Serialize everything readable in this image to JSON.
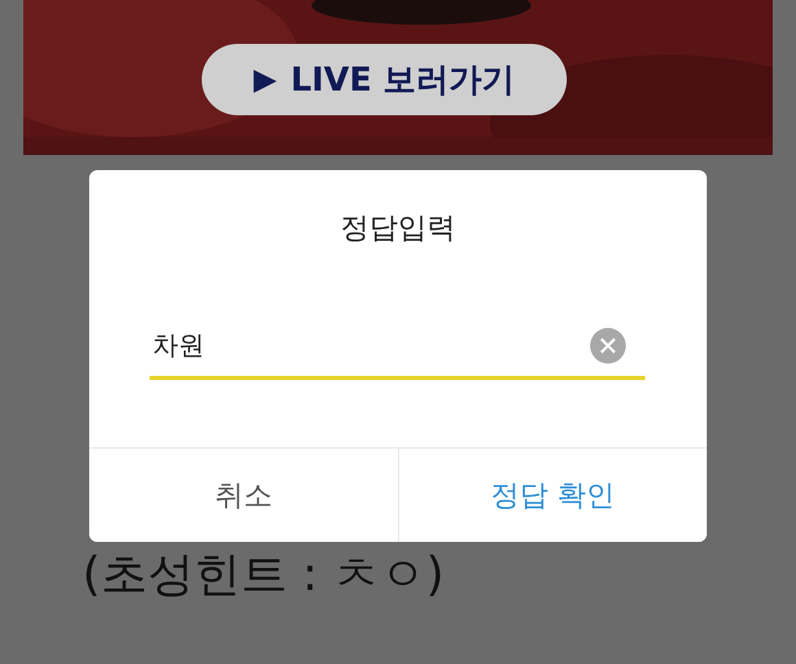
{
  "banner": {
    "kind": "picture",
    "button": {
      "icon": "▶",
      "label": "LIVE 보러가기"
    }
  },
  "hint": "(초성힌트 : ㅊㅇ)",
  "dialog": {
    "title": "정답입력",
    "input": {
      "value": "차원"
    },
    "buttons": [
      {
        "label": "취소",
        "kind": "cancel"
      },
      {
        "label": "정답 확인",
        "kind": "confirm"
      }
    ]
  }
}
